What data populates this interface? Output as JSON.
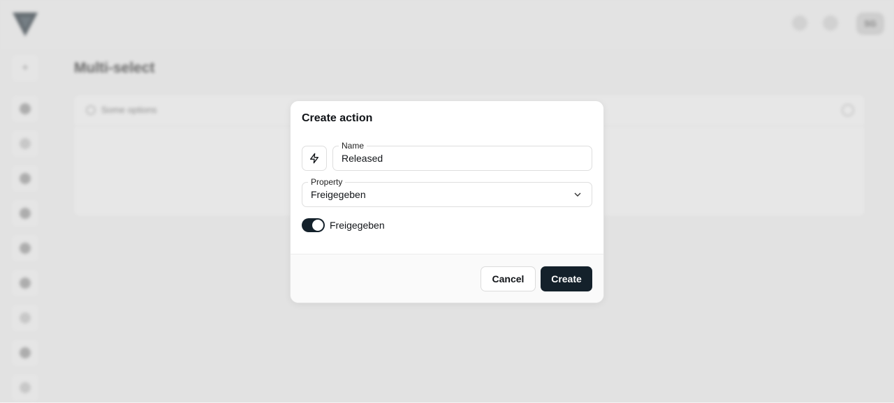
{
  "background": {
    "page_title": "Multi-select",
    "card_header": "Some options",
    "avatar_initials": "SG",
    "rail_icons": [
      "plus-icon",
      "grid-icon",
      "circle-icon",
      "layers-icon",
      "box-icon",
      "chart-icon",
      "settings-icon",
      "globe-icon",
      "stack-icon",
      "tag-icon"
    ]
  },
  "modal": {
    "title": "Create action",
    "icon": "lightning-icon",
    "name_field": {
      "label": "Name",
      "value": "Released"
    },
    "property_field": {
      "label": "Property",
      "value": "Freigegeben"
    },
    "toggle": {
      "label": "Freigegeben",
      "on": true
    },
    "cancel_label": "Cancel",
    "create_label": "Create"
  },
  "colors": {
    "primary": "#14212b",
    "border": "#dedede",
    "footer_bg": "#fafafa"
  }
}
